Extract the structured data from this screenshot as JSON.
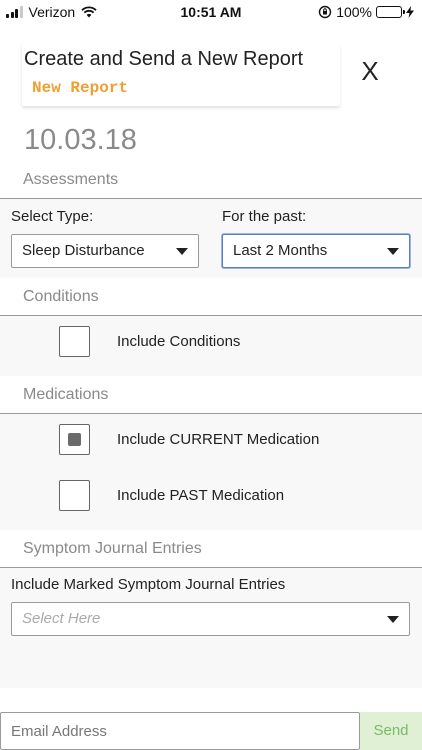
{
  "status_bar": {
    "carrier": "Verizon",
    "time": "10:51 AM",
    "battery_percent": "100%",
    "battery_level": 1.0,
    "battery_color": "#4cd964"
  },
  "header": {
    "title": "Create and Send a New Report",
    "subtitle": "New Report",
    "subtitle_color": "#f0a030",
    "close_label": "X"
  },
  "date": "10.03.18",
  "assessments": {
    "section_label": "Assessments",
    "type_label": "Select Type:",
    "type_value": "Sleep Disturbance",
    "past_label": "For the past:",
    "past_value": "Last 2 Months"
  },
  "conditions": {
    "section_label": "Conditions",
    "include_label": "Include Conditions",
    "include_checked": false
  },
  "medications": {
    "section_label": "Medications",
    "current_label": "Include CURRENT Medication",
    "current_checked": true,
    "past_label": "Include PAST Medication",
    "past_checked": false
  },
  "journal": {
    "section_label": "Symptom Journal Entries",
    "include_label": "Include Marked Symptom Journal Entries",
    "select_placeholder": "Select Here"
  },
  "footer": {
    "email_placeholder": "Email Address",
    "send_label": "Send",
    "send_color": "#7cb96a"
  },
  "icons": [
    "signal-icon",
    "wifi-icon",
    "orientation-lock-icon",
    "battery-icon",
    "charging-icon",
    "chevron-down-icon"
  ]
}
